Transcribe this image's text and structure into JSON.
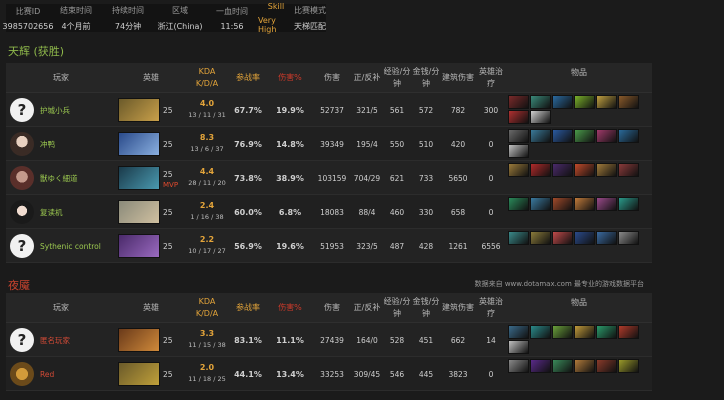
{
  "match_info": [
    {
      "label": "比赛ID",
      "value": "3985702656",
      "gold": false
    },
    {
      "label": "结束时间",
      "value": "4个月前",
      "gold": false
    },
    {
      "label": "持续时间",
      "value": "74分钟",
      "gold": false
    },
    {
      "label": "区域",
      "value": "浙江(China)",
      "gold": false
    },
    {
      "label": "一血时间",
      "value": "11:56",
      "gold": false
    },
    {
      "label": "Skill",
      "value": "Very High",
      "gold": true
    },
    {
      "label": "比赛模式",
      "value": "天梯匹配",
      "gold": false
    }
  ],
  "radiant": {
    "title": "天辉 (获胜)"
  },
  "dire": {
    "title": "夜魇"
  },
  "source_note": "数据来自 www.dotamax.com 最专业的游戏数据平台",
  "headers": {
    "player": "玩家",
    "hero": "英雄",
    "kda_line1": "KDA",
    "kda_line2": "K/D/A",
    "participation": "参战率",
    "damage_pct": "伤害%",
    "damage": "伤害",
    "lh_dn": "正/反补",
    "xpm_line1": "经验/分",
    "xpm_line2": "钟",
    "gpm_line1": "金钱/分",
    "gpm_line2": "钟",
    "building": "建筑伤害",
    "heal": "英雄治疗",
    "items": "物品"
  },
  "radiant_players": [
    {
      "name": "护城小兵",
      "avatar": "q",
      "level": "25",
      "mvp": "",
      "kda": "4.0",
      "kda_detail": "13 / 11 / 31",
      "participation": "67.7%",
      "damage_pct": "19.9%",
      "damage": "52737",
      "lh_dn": "321/5",
      "xpm": "561",
      "gpm": "572",
      "building": "782",
      "heal": "300",
      "hero_colors": [
        "#6b5a2a",
        "#c9a04a"
      ],
      "items": [
        "#7a2a2a",
        "#3a8a7a",
        "#2a6aa0",
        "#7ab02a",
        "#c0a040",
        "#8a5a2a",
        "#b03030",
        "#d0d0d0"
      ]
    },
    {
      "name": "冲鸭",
      "avatar": "photo1",
      "level": "25",
      "mvp": "",
      "kda": "8.3",
      "kda_detail": "13 / 6 / 37",
      "participation": "76.9%",
      "damage_pct": "14.8%",
      "damage": "39349",
      "lh_dn": "195/4",
      "xpm": "550",
      "gpm": "510",
      "building": "420",
      "heal": "0",
      "hero_colors": [
        "#2a4a8a",
        "#8ab0e0"
      ],
      "items": [
        "#6a6a6a",
        "#3a7a9a",
        "#2a5aa0",
        "#4a9a4a",
        "#a03a6a",
        "#2a6a9a",
        "#c0c0c0"
      ]
    },
    {
      "name": "獸ゆく細道",
      "avatar": "photo2",
      "level": "25",
      "mvp": "MVP",
      "kda": "4.4",
      "kda_detail": "28 / 11 / 20",
      "participation": "73.8%",
      "damage_pct": "38.9%",
      "damage": "103159",
      "lh_dn": "704/29",
      "xpm": "621",
      "gpm": "733",
      "building": "5650",
      "heal": "0",
      "hero_colors": [
        "#1a3a4a",
        "#4a9ab0"
      ],
      "items": [
        "#9a7a3a",
        "#b02a2a",
        "#4a2a6a",
        "#c04a2a",
        "#a07a3a",
        "#8a3a3a"
      ]
    },
    {
      "name": "复读机",
      "avatar": "photo3",
      "level": "25",
      "mvp": "",
      "kda": "2.4",
      "kda_detail": "1 / 16 / 38",
      "participation": "60.0%",
      "damage_pct": "6.8%",
      "damage": "18083",
      "lh_dn": "88/4",
      "xpm": "460",
      "gpm": "330",
      "building": "658",
      "heal": "0",
      "hero_colors": [
        "#8a8a7a",
        "#d0c0a0"
      ],
      "items": [
        "#2a8a5a",
        "#3a7aa0",
        "#a04a2a",
        "#c07a3a",
        "#9a4a8a",
        "#2a9a8a"
      ]
    },
    {
      "name": "Sythenic control",
      "avatar": "q",
      "level": "25",
      "mvp": "",
      "kda": "2.2",
      "kda_detail": "10 / 17 / 27",
      "participation": "56.9%",
      "damage_pct": "19.6%",
      "damage": "51953",
      "lh_dn": "323/5",
      "xpm": "487",
      "gpm": "428",
      "building": "1261",
      "heal": "6556",
      "hero_colors": [
        "#4a2a6a",
        "#9a6ac0"
      ],
      "items": [
        "#3a8a8a",
        "#8a7a3a",
        "#c04a4a",
        "#2a4a8a",
        "#3a6aa0",
        "#8a8a8a"
      ]
    }
  ],
  "dire_players": [
    {
      "name": "匿名玩家",
      "avatar": "q",
      "level": "25",
      "mvp": "",
      "kda": "3.3",
      "kda_detail": "11 / 15 / 38",
      "participation": "83.1%",
      "damage_pct": "11.1%",
      "damage": "27439",
      "lh_dn": "164/0",
      "xpm": "528",
      "gpm": "451",
      "building": "662",
      "heal": "14",
      "hero_colors": [
        "#6a3a1a",
        "#d08a3a"
      ],
      "items": [
        "#3a6a8a",
        "#2a8a8a",
        "#6aa03a",
        "#c09a3a",
        "#2a9a6a",
        "#b03a2a",
        "#c0c0c0"
      ]
    },
    {
      "name": "Red",
      "avatar": "photo4",
      "level": "25",
      "mvp": "",
      "kda": "2.0",
      "kda_detail": "11 / 18 / 25",
      "participation": "44.1%",
      "damage_pct": "13.4%",
      "damage": "33253",
      "lh_dn": "309/45",
      "xpm": "546",
      "gpm": "445",
      "building": "3823",
      "heal": "0",
      "hero_colors": [
        "#6a5a2a",
        "#c0a03a"
      ],
      "items": [
        "#8a8a8a",
        "#5a2a8a",
        "#3a8a5a",
        "#b07a3a",
        "#8a3a2a",
        "#9a9a2a"
      ]
    }
  ]
}
